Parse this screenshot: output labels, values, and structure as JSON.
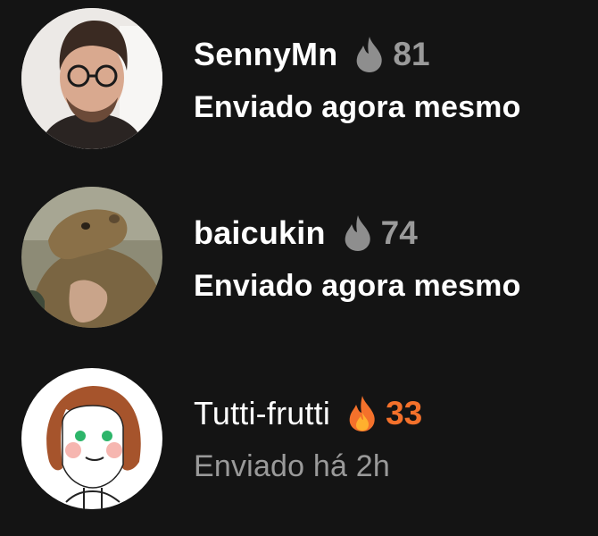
{
  "chats": [
    {
      "username": "SennyMn",
      "streak_icon": "flame-icon",
      "streak_count": "81",
      "status": "Enviado agora mesmo",
      "avatar": "avatar-photo-man-glasses"
    },
    {
      "username": "baicukin",
      "streak_icon": "flame-icon",
      "streak_count": "74",
      "status": "Enviado agora mesmo",
      "avatar": "avatar-photo-capybara"
    },
    {
      "username": "Tutti-frutti",
      "streak_icon": "flame-icon-active",
      "streak_count": "33",
      "status": "Enviado há 2h",
      "avatar": "avatar-drawing-girl"
    }
  ],
  "colors": {
    "background": "#141414",
    "text_primary": "#ffffff",
    "text_muted": "#9a9a9a",
    "flame_inactive": "#8e8e8e",
    "flame_active": "#f4712b"
  }
}
